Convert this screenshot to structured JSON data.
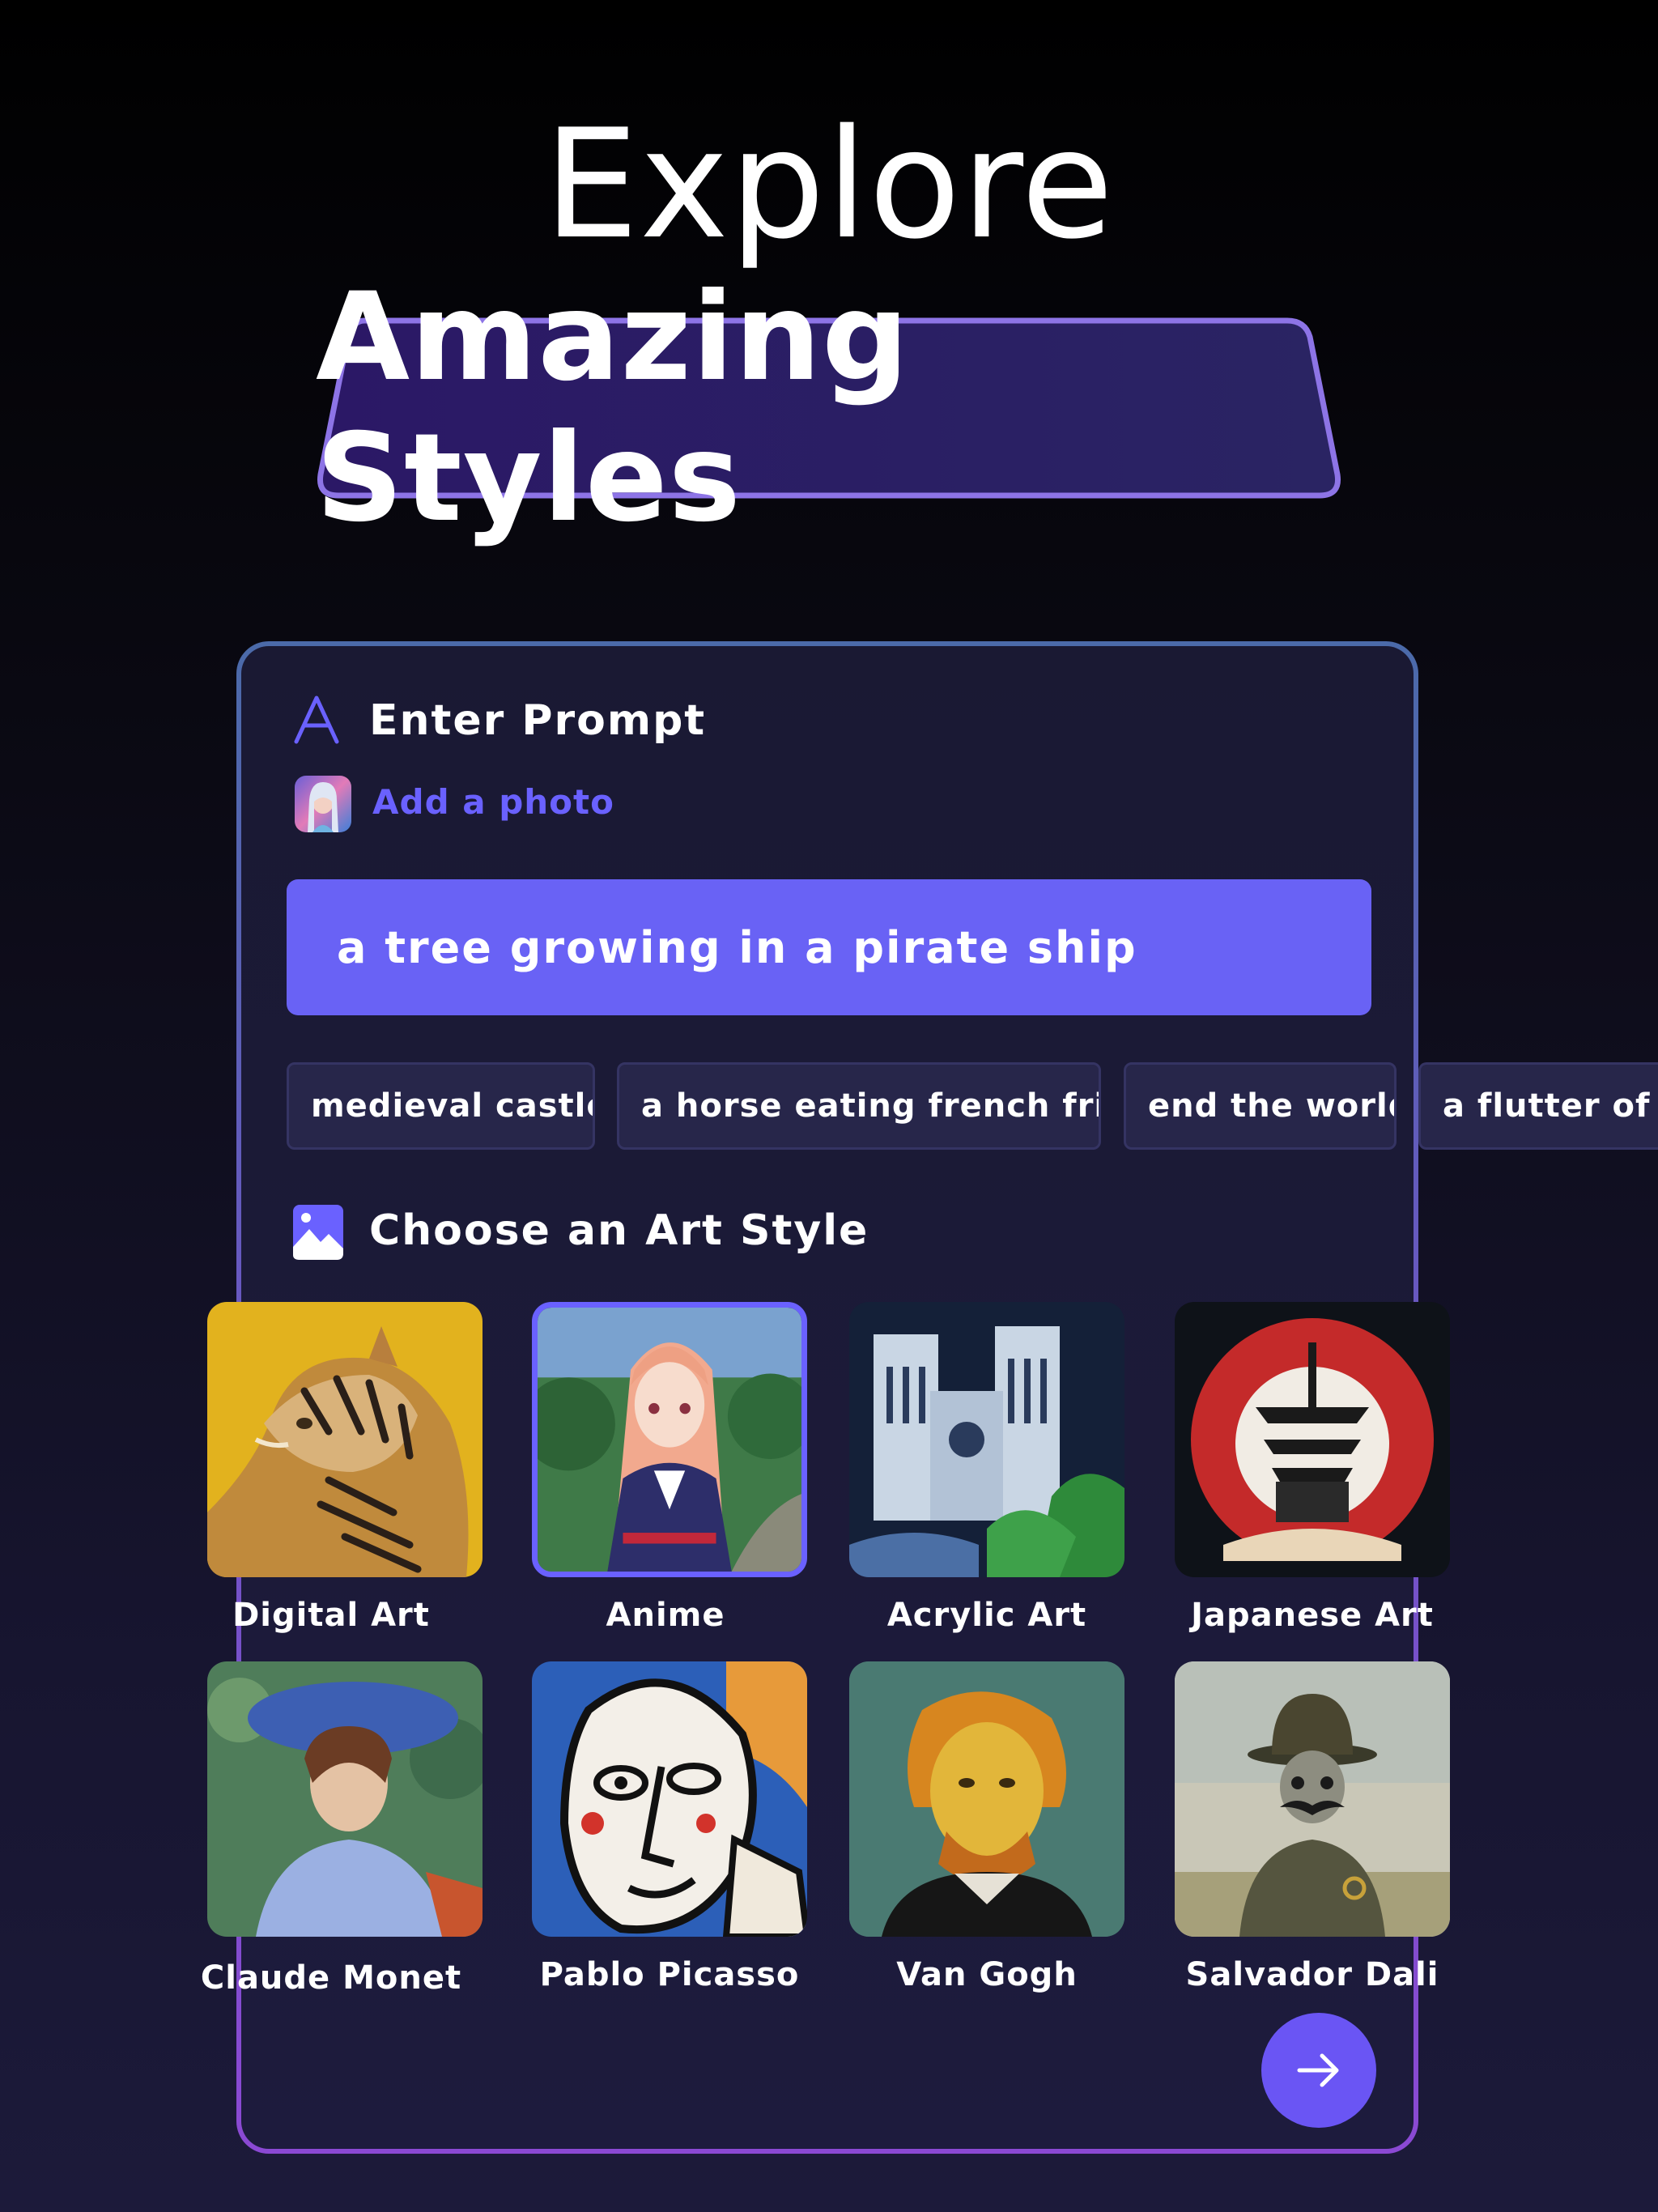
{
  "hero": {
    "headline": "Explore",
    "banner": "Amazing Styles"
  },
  "prompt_section": {
    "icon": "letter-a-icon",
    "title": "Enter Prompt",
    "add_photo_label": "Add a photo",
    "prompt_value": "a tree growing in a pirate ship",
    "suggestions": [
      "medieval castle",
      "a horse eating french fries",
      "end the world",
      "a flutter of koi"
    ]
  },
  "style_section": {
    "icon": "image-icon",
    "title": "Choose an Art Style",
    "styles": [
      {
        "label": "Digital Art",
        "selected": false
      },
      {
        "label": "Anime",
        "selected": true
      },
      {
        "label": "Acrylic Art",
        "selected": false
      },
      {
        "label": "Japanese Art",
        "selected": false
      },
      {
        "label": "Claude Monet",
        "selected": false
      },
      {
        "label": "Pablo Picasso",
        "selected": false
      },
      {
        "label": "Van Gogh",
        "selected": false
      },
      {
        "label": "Salvador Dali",
        "selected": false
      }
    ]
  },
  "next_button": {
    "icon": "arrow-right-icon"
  },
  "colors": {
    "accent": "#6962f5",
    "link": "#6a61ff",
    "chip_bg": "#27264a",
    "card_bg": "#1a1933"
  }
}
